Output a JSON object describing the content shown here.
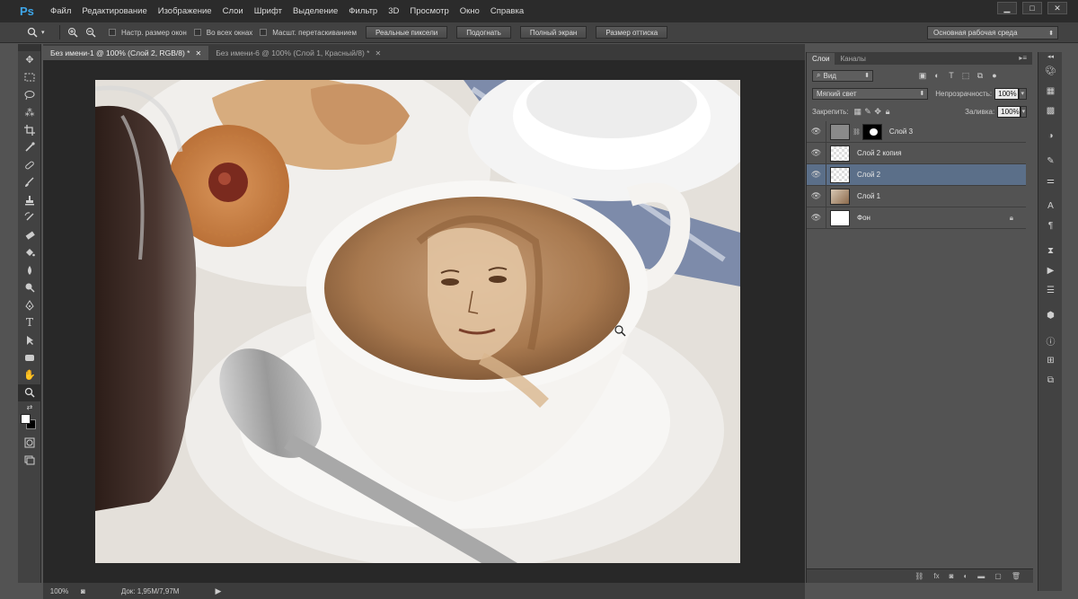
{
  "app": {
    "logo": "Ps"
  },
  "menu": [
    "Файл",
    "Редактирование",
    "Изображение",
    "Слои",
    "Шрифт",
    "Выделение",
    "Фильтр",
    "3D",
    "Просмотр",
    "Окно",
    "Справка"
  ],
  "window_controls": {
    "minimize": "▁",
    "maximize": "□",
    "close": "✕"
  },
  "options_bar": {
    "tool_icon": "zoom-icon",
    "checkboxes": [
      "Настр. размер окон",
      "Во всех окнах",
      "Масшт. перетаскиванием"
    ],
    "buttons": [
      "Реальные пиксели",
      "Подогнать",
      "Полный экран",
      "Размер оттиска"
    ],
    "workspace": "Основная рабочая среда"
  },
  "tabs": [
    {
      "label": "Без имени-1 @ 100% (Слой 2, RGB/8) *",
      "active": true
    },
    {
      "label": "Без имени-6 @ 100% (Слой 1, Красный/8) *",
      "active": false
    }
  ],
  "status": {
    "zoom": "100%",
    "doc": "Док: 1,95M/7,97M",
    "arrow": "▶"
  },
  "layers_panel": {
    "tabs": [
      "Слои",
      "Каналы"
    ],
    "filter_label": "Вид",
    "blend_mode": "Мягкий свет",
    "opacity_label": "Непрозрачность:",
    "opacity": "100%",
    "lock_label": "Закрепить:",
    "fill_label": "Заливка:",
    "fill": "100%",
    "layers": [
      {
        "name": "Слой 3",
        "thumb": "gray",
        "mask": true,
        "locked": false,
        "selected": false
      },
      {
        "name": "Слой 2 копия",
        "thumb": "checker",
        "mask": false,
        "locked": false,
        "selected": false
      },
      {
        "name": "Слой 2",
        "thumb": "checker",
        "mask": false,
        "locked": false,
        "selected": true
      },
      {
        "name": "Слой 1",
        "thumb": "photo",
        "mask": false,
        "locked": false,
        "selected": false
      },
      {
        "name": "Фон",
        "thumb": "white",
        "mask": false,
        "locked": true,
        "selected": false
      }
    ]
  },
  "colors": {
    "selected_layer": "#5b6f89",
    "accent": "#3ea6e8"
  }
}
